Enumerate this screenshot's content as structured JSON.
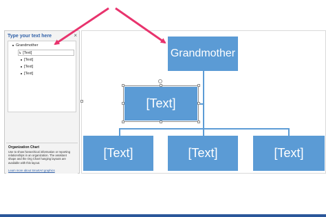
{
  "text_pane": {
    "title": "Type your text here",
    "close": "×",
    "items": [
      {
        "label": "Grandmother"
      },
      {
        "label": "[Text]"
      },
      {
        "label": "[Text]"
      },
      {
        "label": "[Text]"
      },
      {
        "label": "[Text]"
      }
    ],
    "info_title": "Organization Chart",
    "info_desc": "Use to show hierarchical information or reporting relationships in an organization. The assistant shape and the Org Chart hanging layouts are available with this layout.",
    "info_link": "Learn more about SmartArt graphics"
  },
  "diagram": {
    "top_node": "Grandmother",
    "assistant_node": "[Text]",
    "child_nodes": [
      "[Text]",
      "[Text]",
      "[Text]"
    ]
  },
  "colors": {
    "node": "#5b9bd5",
    "arrow": "#e8336d",
    "pane_title": "#2e5fa8"
  }
}
